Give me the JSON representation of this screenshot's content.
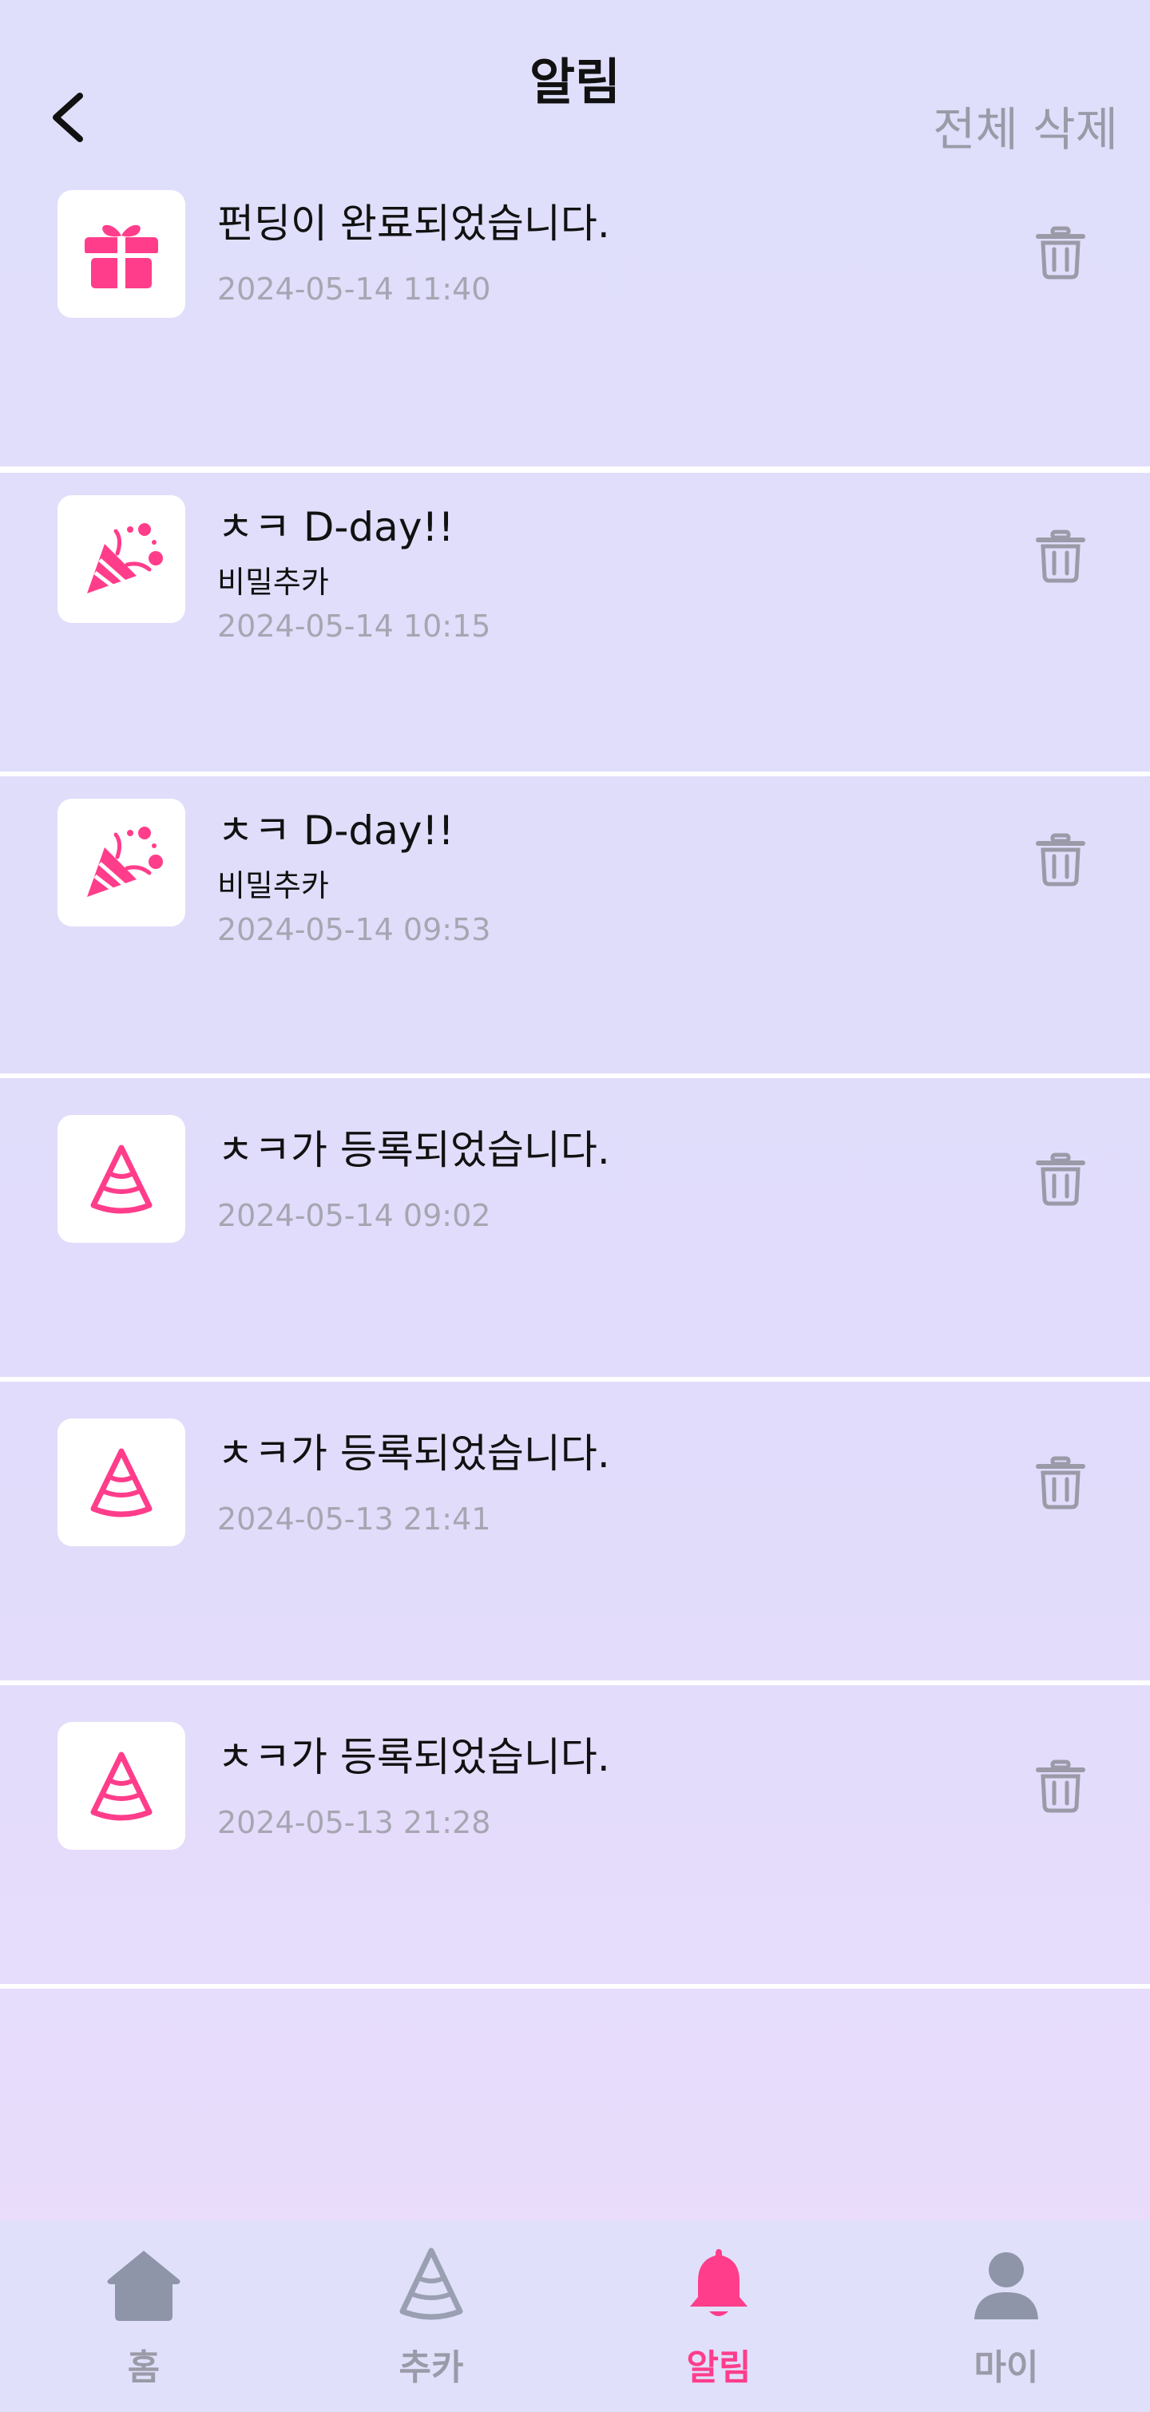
{
  "header": {
    "title": "알림",
    "delete_all": "전체 삭제"
  },
  "notifications": [
    {
      "icon": "gift-icon",
      "message": "펀딩이 완료되었습니다.",
      "sub": "",
      "time": "2024-05-14 11:40"
    },
    {
      "icon": "party-popper-icon",
      "message": "ㅊㅋ D-day!!",
      "sub": "비밀추카",
      "time": "2024-05-14 10:15"
    },
    {
      "icon": "party-popper-icon",
      "message": "ㅊㅋ D-day!!",
      "sub": "비밀추카",
      "time": "2024-05-14 09:53"
    },
    {
      "icon": "party-hat-icon",
      "message": "ㅊㅋ가 등록되었습니다.",
      "sub": "",
      "time": "2024-05-14 09:02"
    },
    {
      "icon": "party-hat-icon",
      "message": "ㅊㅋ가 등록되었습니다.",
      "sub": "",
      "time": "2024-05-13 21:41"
    },
    {
      "icon": "party-hat-icon",
      "message": "ㅊㅋ가 등록되었습니다.",
      "sub": "",
      "time": "2024-05-13 21:28"
    }
  ],
  "tabbar": {
    "items": [
      {
        "label": "홈",
        "icon": "home-icon"
      },
      {
        "label": "추카",
        "icon": "party-hat-icon"
      },
      {
        "label": "알림",
        "icon": "bell-icon",
        "active": true
      },
      {
        "label": "마이",
        "icon": "user-icon"
      }
    ]
  },
  "colors": {
    "accent": "#ff3d8b",
    "inactive": "#9a9aa8",
    "background": "#e0e0fb"
  }
}
